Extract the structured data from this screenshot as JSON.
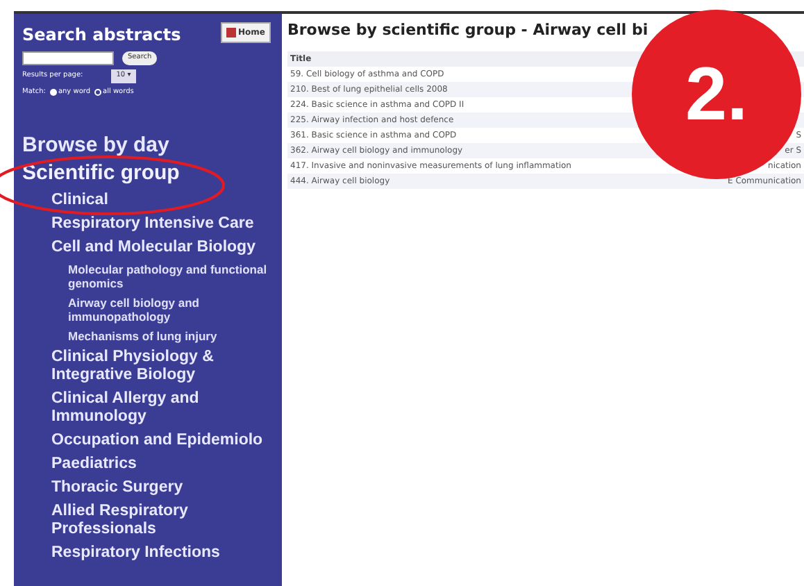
{
  "sidebar": {
    "search_title": "Search abstracts",
    "search_button": "Search",
    "results_label": "Results per page:",
    "results_select": "10",
    "results_select_arrow": "▾",
    "match_label": "Match:",
    "match_options": [
      {
        "label": "any word",
        "selected": true
      },
      {
        "label": "all words",
        "selected": false
      }
    ],
    "home_button": "Home",
    "browse_by_day": "Browse by day",
    "scientific_group": "Scientific group",
    "groups": [
      {
        "label": "Clinical"
      },
      {
        "label": "Respiratory Intensive Care"
      },
      {
        "label": "Cell and Molecular Biology",
        "children": [
          {
            "label": "Molecular pathology and functional genomics"
          },
          {
            "label": "Airway cell biology and immunopathology"
          },
          {
            "label": "Mechanisms of lung injury"
          }
        ]
      },
      {
        "label": "Clinical Physiology & Integrative Biology"
      },
      {
        "label": "Clinical Allergy and Immunology"
      },
      {
        "label": "Occupation and Epidemiolo"
      },
      {
        "label": "Paediatrics"
      },
      {
        "label": "Thoracic Surgery"
      },
      {
        "label": "Allied Respiratory Professionals"
      },
      {
        "label": "Respiratory Infections"
      }
    ]
  },
  "main": {
    "title": "Browse by scientific group - Airway cell bi",
    "table": {
      "columns": [
        "Title"
      ],
      "rows": [
        {
          "title": "59. Cell biology of asthma and COPD"
        },
        {
          "title": "210. Best of lung epithelial cells 2008"
        },
        {
          "title": "224. Basic science in asthma and COPD II"
        },
        {
          "title": "225. Airway infection and host defence"
        },
        {
          "title": "361. Basic science in asthma and COPD",
          "column_2": "S"
        },
        {
          "title": "362. Airway cell biology and immunology",
          "column_2": "er S"
        },
        {
          "title": "417. Invasive and noninvasive measurements of lung inflammation",
          "column_2": "nication"
        },
        {
          "title": "444. Airway cell biology",
          "column_2": "E Communication"
        }
      ]
    }
  },
  "annotation": {
    "label": "2."
  }
}
